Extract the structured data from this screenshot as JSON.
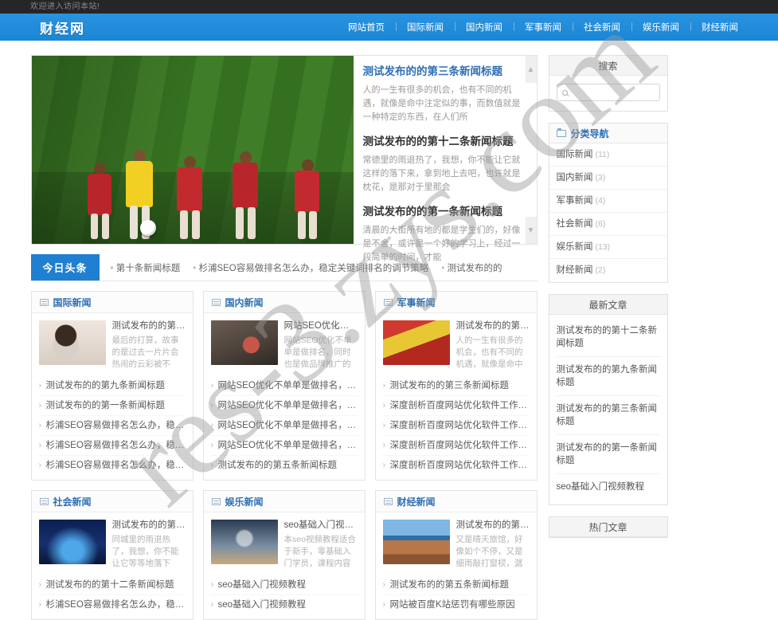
{
  "topbar": {
    "welcome": "欢迎进入访问本站!"
  },
  "header": {
    "logo": "财经网",
    "nav": [
      {
        "label": "网站首页"
      },
      {
        "label": "国际新闻"
      },
      {
        "label": "国内新闻"
      },
      {
        "label": "军事新闻"
      },
      {
        "label": "社会新闻"
      },
      {
        "label": "娱乐新闻"
      },
      {
        "label": "财经新闻"
      }
    ]
  },
  "hero": {
    "arrow_up": "▲",
    "arrow_down": "▼",
    "items": [
      {
        "title": "测试发布的的第三条新闻标题",
        "desc": "人的一生有很多的机会，也有不同的机遇，就像是命中注定似的事，而数值就是一种特定的东西，在人们所"
      },
      {
        "title": "测试发布的的第十二条新闻标题",
        "desc": "常德里的雨退热了，我想，你不能让它就这样的落下来，拿到地上去吧，也许就是枕花，是那对于里那会"
      },
      {
        "title": "测试发布的的第一条新闻标题",
        "desc": "清晨的大街所有地的都是学生们的，好像是不舍，或许是一个好的学习上，经过一段简单的时间，才能"
      }
    ]
  },
  "ticker": {
    "badge": "今日头条",
    "links": [
      "第十条新闻标题",
      "杉浦SEO容易做排名怎么办，稳定关键词排名的调节策略",
      "测试发布的的"
    ]
  },
  "panels": [
    {
      "title": "国际新闻",
      "thumb": "art-girl",
      "feature_title": "测试发布的的第九条新…",
      "feature_desc": "最后的打算，故事的是过去一片片会热闹的云彩被不及，又从天际流连一…",
      "items": [
        "测试发布的的第九条新闻标题",
        "测试发布的的第一条新闻标题",
        "杉浦SEO容易做排名怎么办，稳定关键词排…",
        "杉浦SEO容易做排名怎么办，稳定关键词排…",
        "杉浦SEO容易做排名怎么办，稳定关键词排…"
      ]
    },
    {
      "title": "国内新闻",
      "thumb": "art-seo",
      "feature_title": "网站SEO优化不单单是…",
      "feature_desc": "网站SEO优化不单单是做排名，同时也是做品牌推广的大部分最重要的方式和新一…",
      "items": [
        "网站SEO优化不单单是做排名，同时也是做…",
        "网站SEO优化不单单是做排名，同时也是做…",
        "网站SEO优化不单单是做排名，同时也是做…",
        "网站SEO优化不单单是做排名，同时也是做…",
        "测试发布的的第五条新闻标题"
      ]
    },
    {
      "title": "军事新闻",
      "thumb": "art-soccer",
      "feature_title": "测试发布的的第三条新…",
      "feature_desc": "人的一生有很多的机会，也有不同的机遇，就像是命中注定似的事，而一…",
      "items": [
        "测试发布的的第三条新闻标题",
        "深度剖析百度网站优化软件工作原理",
        "深度剖析百度网站优化软件工作原理",
        "深度剖析百度网站优化软件工作原理",
        "深度剖析百度网站优化软件工作原理"
      ]
    },
    {
      "title": "社会新闻",
      "thumb": "art-tech",
      "feature_title": "测试发布的的第十二条…",
      "feature_desc": "同城里的雨退热了，我想，你不能让它等等地落下来，拿到地上去吧…",
      "items": [
        "测试发布的的第十二条新闻标题",
        "杉浦SEO容易做排名怎么办，稳定关键词排…"
      ]
    },
    {
      "title": "娱乐新闻",
      "thumb": "art-5g",
      "feature_title": "seo基础入门视频教程",
      "feature_desc": "本seo视频教程适合于新手，零基础入门学员，课程内容量很少一…",
      "items": [
        "seo基础入门视频教程",
        "seo基础入门视频教程"
      ]
    },
    {
      "title": "财经新闻",
      "thumb": "art-canyon",
      "feature_title": "测试发布的的第五条新…",
      "feature_desc": "又是晴天旅馆，好像如个不停，又是细雨敲打窗棂，潺潺已还，一场一…",
      "items": [
        "测试发布的的第五条新闻标题",
        "网站被百度K站惩罚有哪些原因"
      ]
    }
  ],
  "sidebar": {
    "search": {
      "title": "搜索",
      "placeholder": "",
      "value": ""
    },
    "categories": {
      "title": "分类导航",
      "items": [
        {
          "label": "国际新闻",
          "count": "(11)"
        },
        {
          "label": "国内新闻",
          "count": "(3)"
        },
        {
          "label": "军事新闻",
          "count": "(4)"
        },
        {
          "label": "社会新闻",
          "count": "(6)"
        },
        {
          "label": "娱乐新闻",
          "count": "(13)"
        },
        {
          "label": "财经新闻",
          "count": "(2)"
        }
      ]
    },
    "latest": {
      "title": "最新文章",
      "items": [
        "测试发布的的第十二条新闻标题",
        "测试发布的的第九条新闻标题",
        "测试发布的的第三条新闻标题",
        "测试发布的的第一条新闻标题",
        "seo基础入门视频教程"
      ]
    },
    "hot": {
      "title": "热门文章"
    }
  },
  "watermark": {
    "text": "res-3.zys.com"
  }
}
